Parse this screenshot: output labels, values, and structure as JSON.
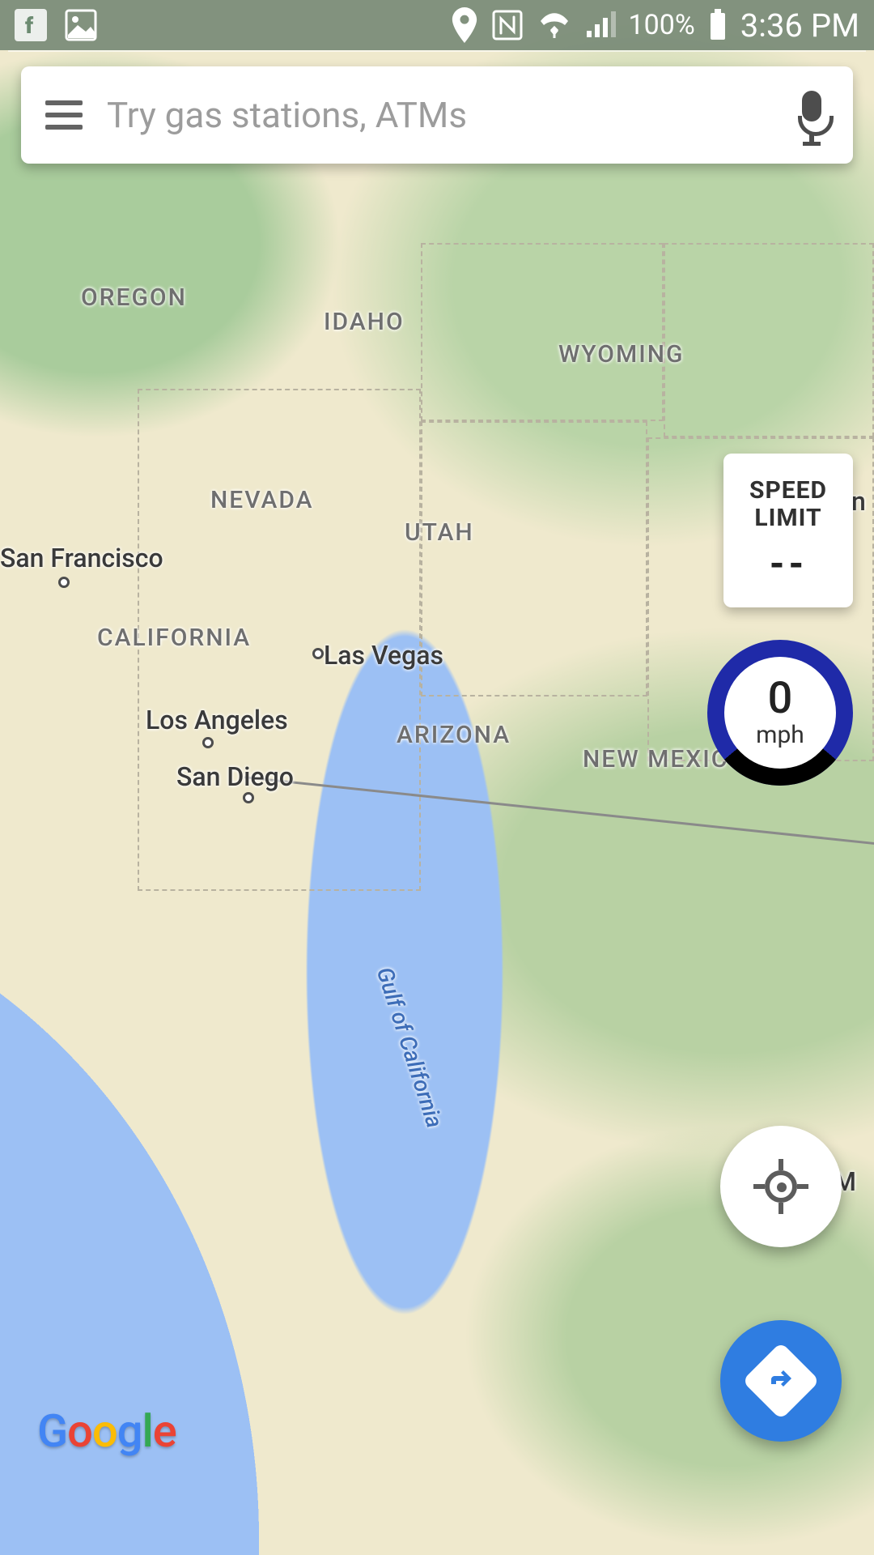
{
  "status_bar": {
    "battery_percent": "100%",
    "time": "3:36 PM"
  },
  "search": {
    "placeholder": "Try gas stations, ATMs",
    "value": ""
  },
  "speed_limit": {
    "label_line1": "SPEED",
    "label_line2": "LIMIT",
    "value": "--"
  },
  "speedometer": {
    "value": "0",
    "unit": "mph"
  },
  "map_labels": {
    "states": {
      "oregon": {
        "text": "OREGON"
      },
      "idaho": {
        "text": "IDAHO"
      },
      "wyoming": {
        "text": "WYOMING"
      },
      "nevada": {
        "text": "NEVADA"
      },
      "utah": {
        "text": "UTAH"
      },
      "california": {
        "text": "CALIFORNIA"
      },
      "arizona": {
        "text": "ARIZONA"
      },
      "new_mexico": {
        "text": "NEW MEXICO"
      }
    },
    "cities": {
      "san_francisco": {
        "text": "San Francisco"
      },
      "las_vegas": {
        "text": "Las Vegas"
      },
      "los_angeles": {
        "text": "Los Angeles"
      },
      "san_diego": {
        "text": "San Diego"
      }
    },
    "countries_partial": {
      "un": {
        "text": "Un"
      },
      "mexico": {
        "text": "M"
      }
    },
    "water": {
      "gulf_of_california": {
        "text": "Gulf of California"
      }
    }
  },
  "attribution": "Google"
}
